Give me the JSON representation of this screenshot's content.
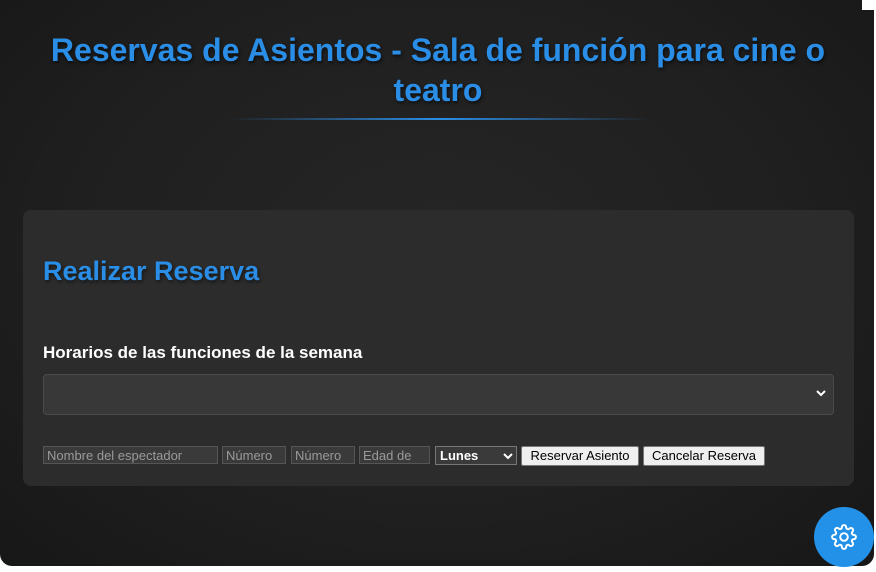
{
  "header": {
    "title": "Reservas de Asientos - Sala de función para cine o teatro"
  },
  "reservation_form": {
    "heading": "Realizar Reserva",
    "schedule_label": "Horarios de las funciones de la semana",
    "schedule_selected": "",
    "name_placeholder": "Nombre del espectador",
    "number_placeholder_1": "Número",
    "number_placeholder_2": "Número",
    "age_placeholder": "Edad de",
    "day_selected": "Lunes",
    "reserve_button": "Reservar Asiento",
    "cancel_button": "Cancelar Reserva"
  },
  "settings": {
    "icon": "gear-icon"
  },
  "colors": {
    "accent": "#2b8ee6",
    "background": "#1f1f1f",
    "card": "#2c2c2c"
  }
}
